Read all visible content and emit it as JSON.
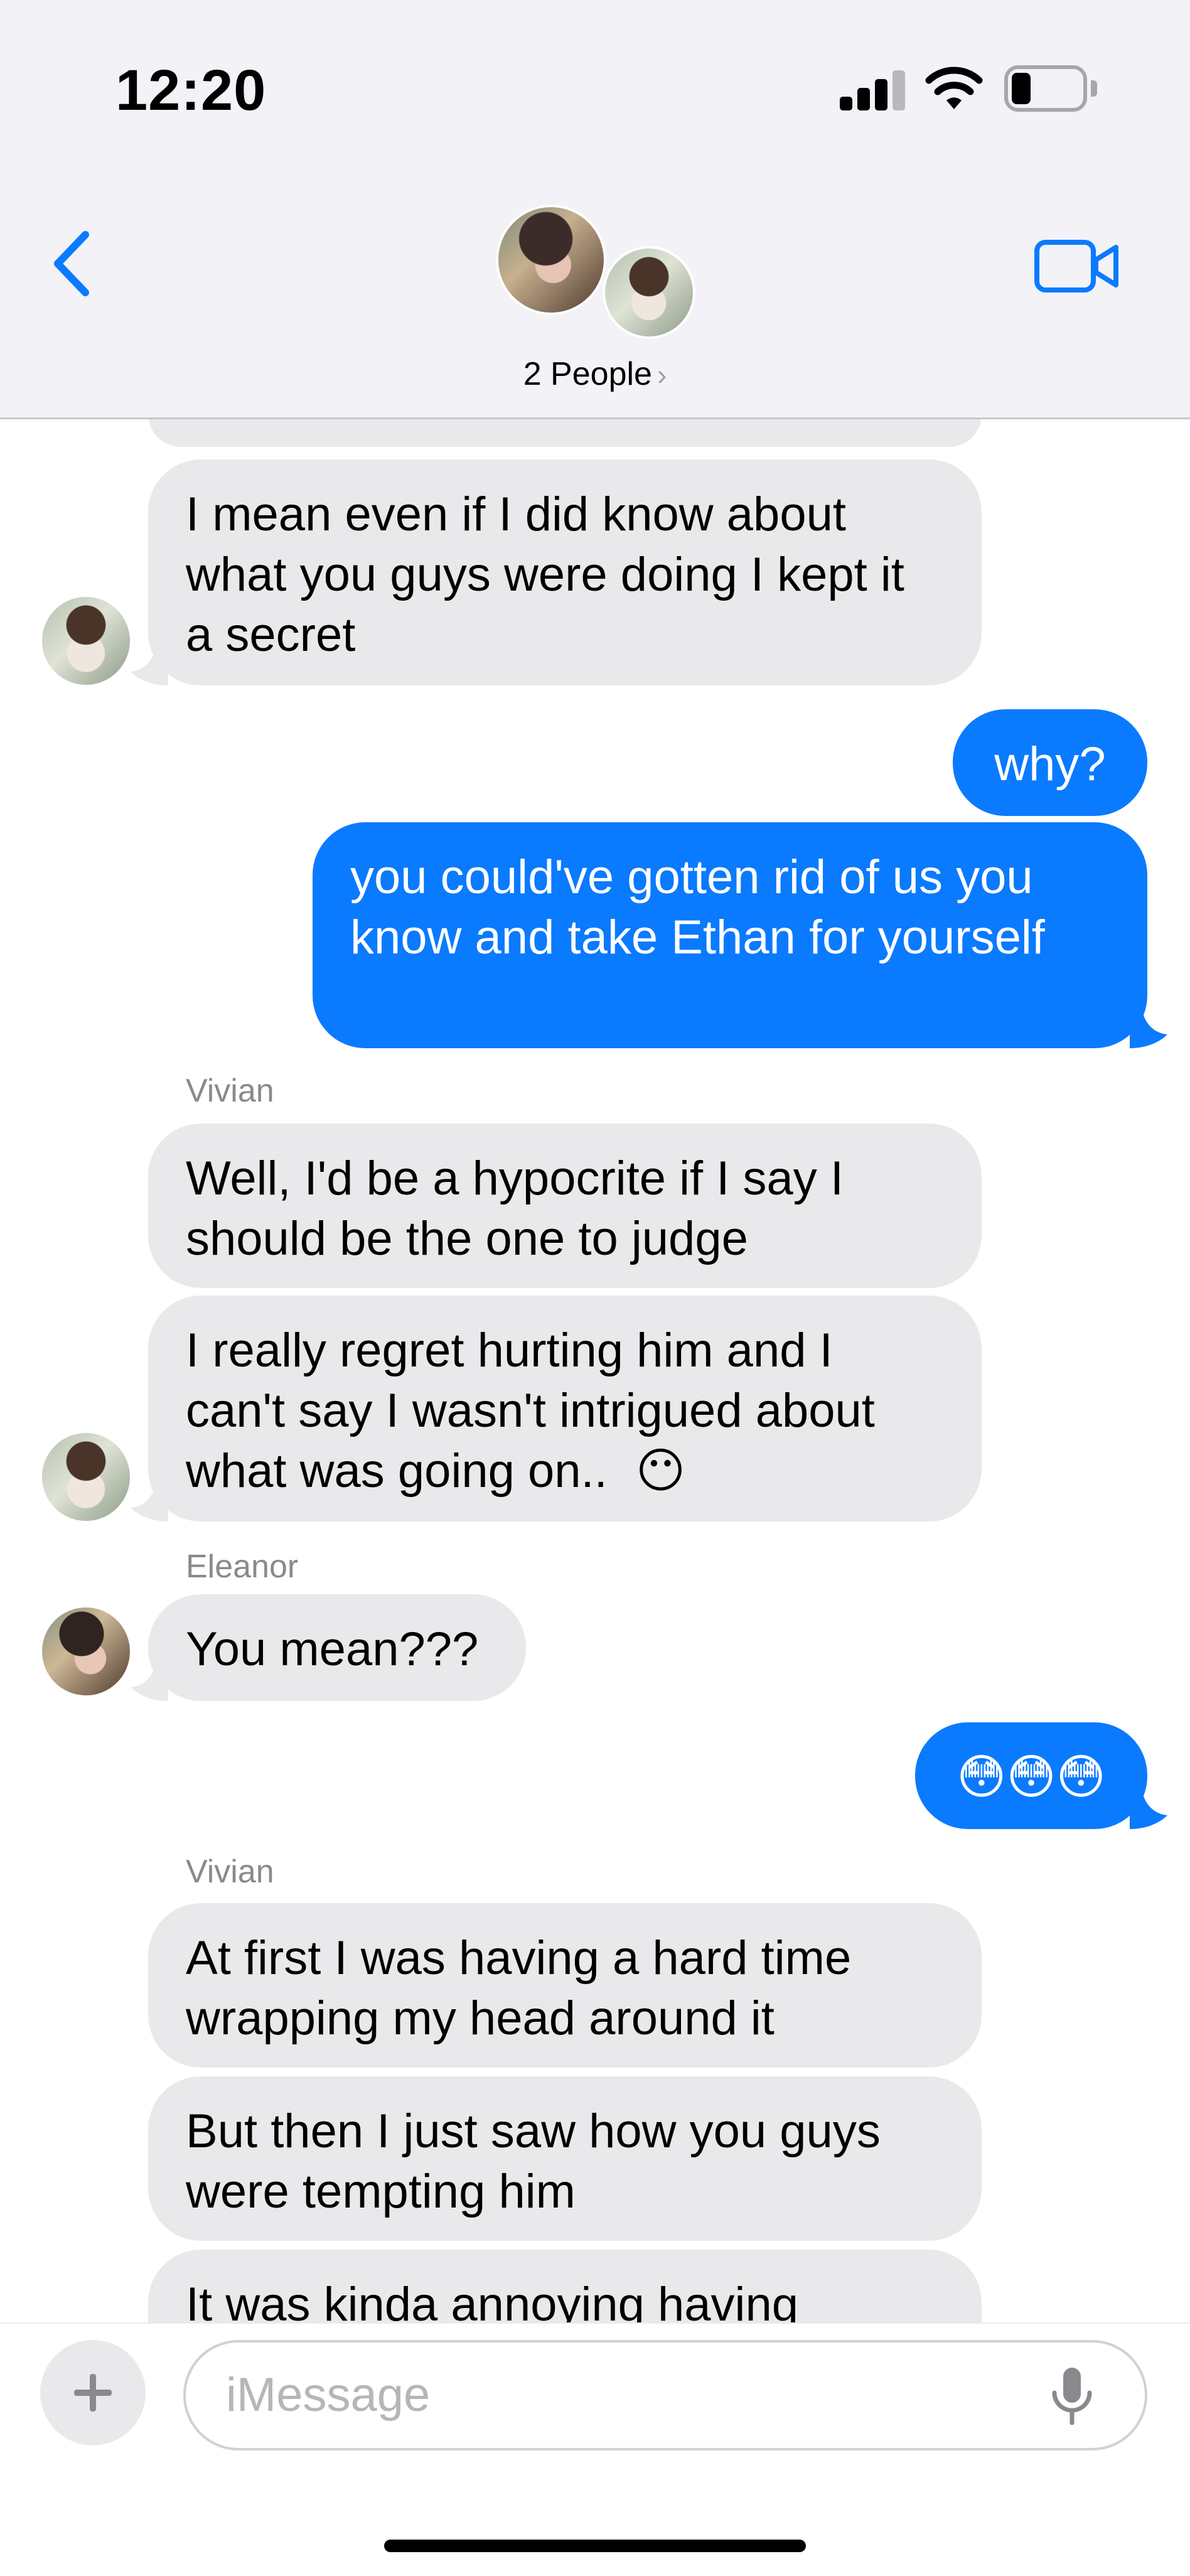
{
  "status_bar": {
    "time": "12:20"
  },
  "header": {
    "back_icon": "chevron-left-icon",
    "video_icon": "video-camera-icon",
    "people_label": "2 People",
    "people_chevron": "›"
  },
  "messages": [
    {
      "id": "m0",
      "direction": "in",
      "text": ""
    },
    {
      "id": "m1",
      "direction": "in",
      "text": "I mean even if I did know about what you guys were doing I kept it a secret"
    },
    {
      "id": "m2",
      "direction": "out",
      "text": "why?"
    },
    {
      "id": "m3",
      "direction": "out",
      "text": "you could've gotten rid of us you know and take Ethan for yourself"
    },
    {
      "id": "m4",
      "direction": "in",
      "sender": "Vivian",
      "text": "Well, I'd be a hypocrite if I say I should be the one to judge"
    },
    {
      "id": "m5",
      "direction": "in",
      "text": "I really regret hurting him and I can't say I wasn't intrigued about what was going on..",
      "emoji": "😶"
    },
    {
      "id": "m6",
      "direction": "in",
      "sender": "Eleanor",
      "text": "You mean???"
    },
    {
      "id": "m7",
      "direction": "out",
      "text": "😳😳😳"
    },
    {
      "id": "m8",
      "direction": "in",
      "sender": "Vivian",
      "text": "At first I was having a hard time wrapping my head around it"
    },
    {
      "id": "m9",
      "direction": "in",
      "text": "But then I just saw how you guys were tempting him"
    },
    {
      "id": "m10",
      "direction": "in",
      "text": "It was kinda annoying having"
    }
  ],
  "input_bar": {
    "placeholder": "iMessage",
    "plus_icon": "plus-icon",
    "mic_icon": "microphone-icon"
  },
  "colors": {
    "outgoing_bubble": "#0a7aff",
    "incoming_bubble": "#e9e9eb",
    "accent": "#0a7aff"
  }
}
